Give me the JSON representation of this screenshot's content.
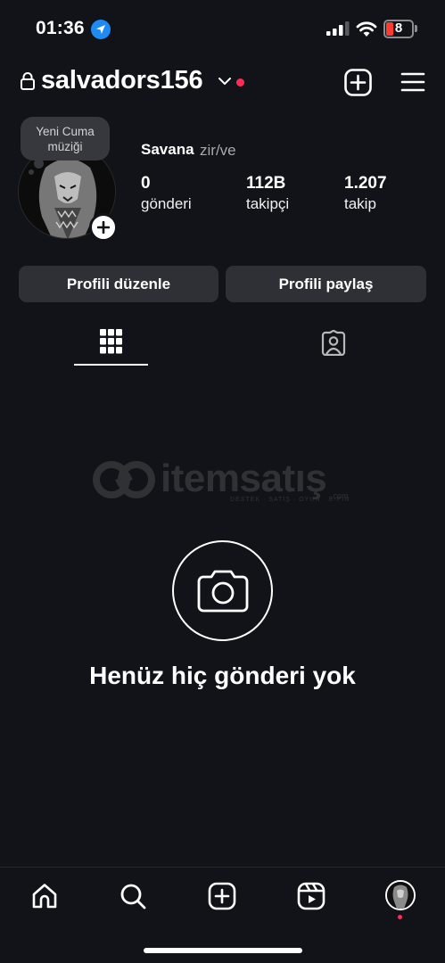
{
  "status_bar": {
    "time": "01:36",
    "battery": "8"
  },
  "header": {
    "username": "salvadors156"
  },
  "profile": {
    "note": "Yeni Cuma müziği",
    "name": "Savana",
    "pronouns": "zir/ve",
    "stats": [
      {
        "value": "0",
        "label": "gönderi"
      },
      {
        "value": "112B",
        "label": "takipçi"
      },
      {
        "value": "1.207",
        "label": "takip"
      }
    ]
  },
  "actions": {
    "edit_profile": "Profili düzenle",
    "share_profile": "Profili paylaş"
  },
  "watermark": {
    "brand": "itemsatış",
    "tagline": "DESTEK · SATIŞ · OYUN · E-PIN",
    "domain": ".com"
  },
  "empty_state": {
    "message": "Henüz hiç gönderi yok"
  },
  "colors": {
    "background": "#111318",
    "button": "#2e3036",
    "notification_dot": "#ff2d55",
    "location": "#1e8bf5",
    "battery_low": "#ff3b30"
  }
}
